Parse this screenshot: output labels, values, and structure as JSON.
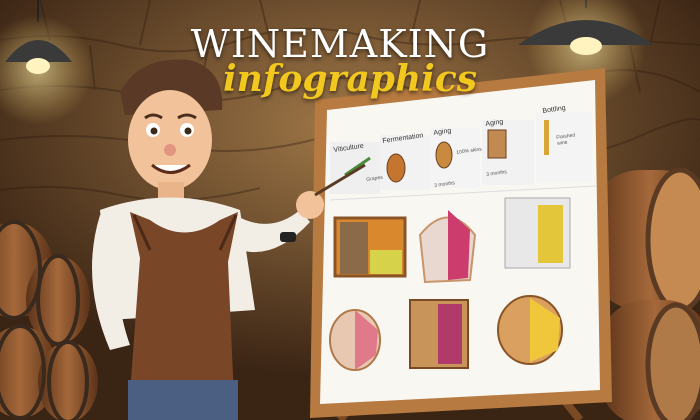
{
  "title": {
    "line1": "WINEMAKING",
    "line2": "infographics"
  },
  "board": {
    "stages": [
      {
        "label": "Viticulture",
        "note": "Grapes"
      },
      {
        "label": "Fermentation",
        "note": "3 months"
      },
      {
        "label": "Aging",
        "note": "3 months"
      },
      {
        "label": "Aging",
        "note": "100% skins"
      },
      {
        "label": "Bottling",
        "note": "Finished wine"
      }
    ]
  }
}
